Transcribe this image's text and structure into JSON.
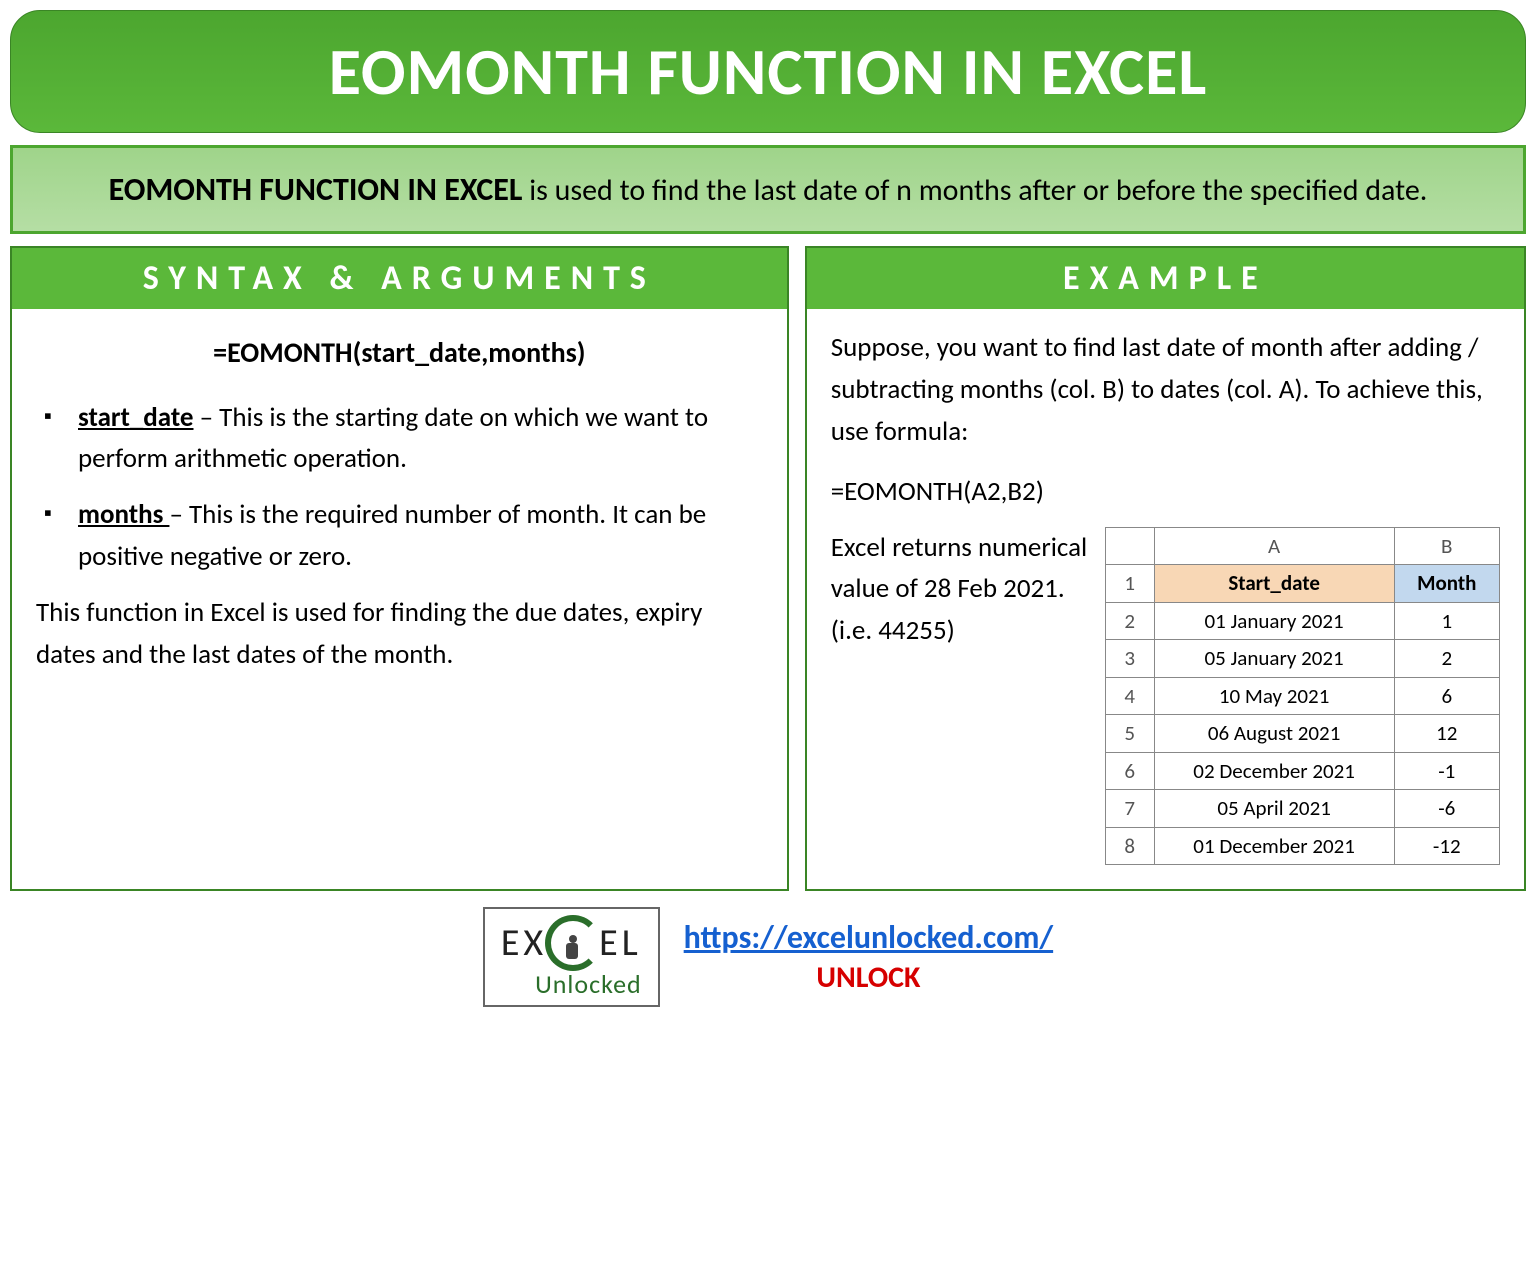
{
  "header": {
    "title": "EOMONTH FUNCTION IN EXCEL"
  },
  "intro": {
    "strong": "EOMONTH FUNCTION IN EXCEL",
    "rest": " is used to find the last date of n months after or before the specified date."
  },
  "left": {
    "heading": "SYNTAX & ARGUMENTS",
    "formula": "=EOMONTH(start_date,months)",
    "args": [
      {
        "name": "start_date",
        "desc": " – This is the starting date on which we want to perform arithmetic operation."
      },
      {
        "name": "months ",
        "desc": "– This is the required number of month. It can be positive negative or zero."
      }
    ],
    "note": "This function in Excel is used for finding the due dates, expiry dates and the last dates of the month."
  },
  "right": {
    "heading": "EXAMPLE",
    "intro": "Suppose, you want to find last date of month after adding / subtracting months (col. B) to dates (col. A). To achieve this, use formula:",
    "formula": "=EOMONTH(A2,B2)",
    "result_text": "Excel returns numerical value of 28 Feb 2021. (i.e. 44255)",
    "table": {
      "cols": [
        "A",
        "B"
      ],
      "headers": [
        "Start_date",
        "Month"
      ],
      "rows": [
        {
          "n": "1",
          "a": "Start_date",
          "b": "Month",
          "isHeader": true
        },
        {
          "n": "2",
          "a": "01 January 2021",
          "b": "1"
        },
        {
          "n": "3",
          "a": "05 January 2021",
          "b": "2"
        },
        {
          "n": "4",
          "a": "10 May 2021",
          "b": "6"
        },
        {
          "n": "5",
          "a": "06 August 2021",
          "b": "12"
        },
        {
          "n": "6",
          "a": "02 December 2021",
          "b": "-1"
        },
        {
          "n": "7",
          "a": "05 April 2021",
          "b": "-6"
        },
        {
          "n": "8",
          "a": "01 December 2021",
          "b": "-12"
        }
      ]
    }
  },
  "footer": {
    "logo_line1": "EX",
    "logo_line1b": "EL",
    "logo_line2": "Unlocked",
    "url": "https://excelunlocked.com/",
    "unlock": "UNLOCK"
  }
}
